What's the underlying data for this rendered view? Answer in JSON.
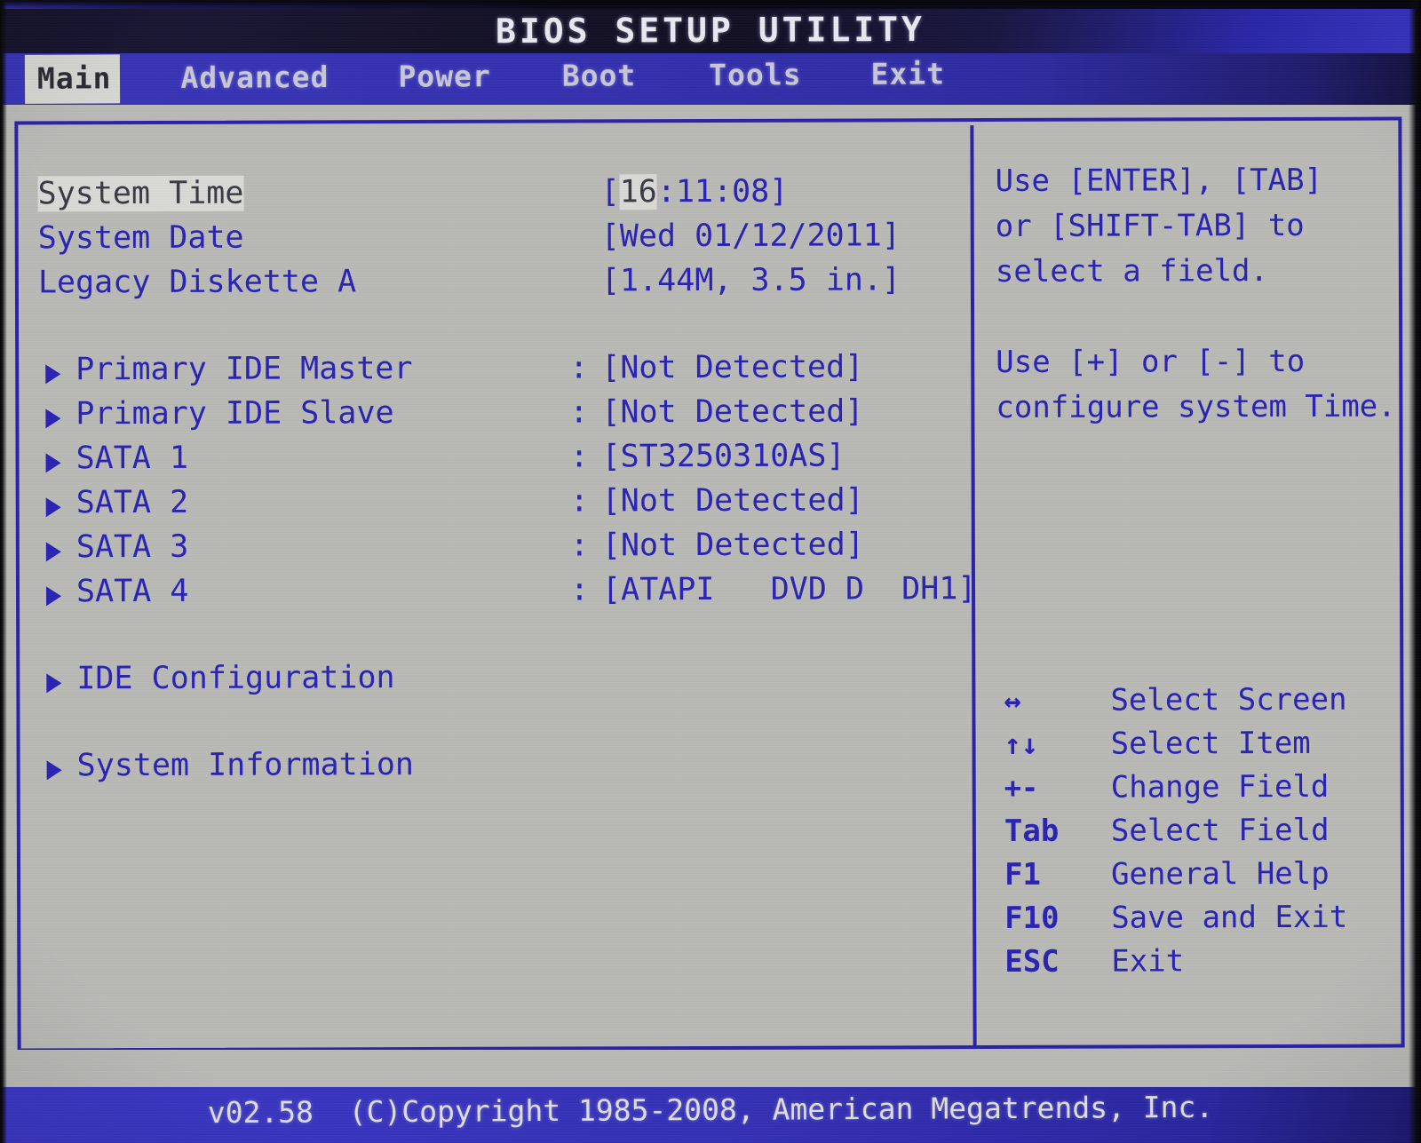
{
  "title": "BIOS SETUP UTILITY",
  "tabs": [
    {
      "label": "Main",
      "active": true
    },
    {
      "label": "Advanced",
      "active": false
    },
    {
      "label": "Power",
      "active": false
    },
    {
      "label": "Boot",
      "active": false
    },
    {
      "label": "Tools",
      "active": false
    },
    {
      "label": "Exit",
      "active": false
    }
  ],
  "main": {
    "system_time": {
      "label": "System Time",
      "value_prefix": "[",
      "value_selected": "16",
      "value_suffix": ":11:08]"
    },
    "system_date": {
      "label": "System Date",
      "value": "[Wed 01/12/2011]"
    },
    "legacy_diskette": {
      "label": "Legacy Diskette A",
      "value": "[1.44M, 3.5 in.]"
    },
    "drives": [
      {
        "label": "Primary IDE Master",
        "colon": ":",
        "value": "[Not Detected]"
      },
      {
        "label": "Primary IDE Slave",
        "colon": ":",
        "value": "[Not Detected]"
      },
      {
        "label": "SATA 1",
        "colon": ":",
        "value": "[ST3250310AS]"
      },
      {
        "label": "SATA 2",
        "colon": ":",
        "value": "[Not Detected]"
      },
      {
        "label": "SATA 3",
        "colon": ":",
        "value": "[Not Detected]"
      },
      {
        "label": "SATA 4",
        "colon": ":",
        "value": "[ATAPI   DVD D  DH1]"
      }
    ],
    "submenus": [
      {
        "label": "IDE Configuration"
      },
      {
        "label": "System Information"
      }
    ]
  },
  "help": {
    "line1": "Use [ENTER], [TAB]",
    "line2": "or [SHIFT-TAB] to",
    "line3": "select a field.",
    "line4": "Use [+] or [-] to",
    "line5": "configure system Time."
  },
  "keys": [
    {
      "key": "↔",
      "desc": "Select Screen"
    },
    {
      "key": "↑↓",
      "desc": "Select Item"
    },
    {
      "key": "+-",
      "desc": "Change Field"
    },
    {
      "key": "Tab",
      "desc": "Select Field"
    },
    {
      "key": "F1",
      "desc": "General Help"
    },
    {
      "key": "F10",
      "desc": "Save and Exit"
    },
    {
      "key": "ESC",
      "desc": "Exit"
    }
  ],
  "footer": {
    "text": "v02.58  (C)Copyright 1985-2008, American Megatrends, Inc."
  },
  "colors": {
    "text_blue": "#2a22b4",
    "panel_bg": "#b9b9b6",
    "bar_blue": "#3531b6",
    "selected_bg": "#d9d9d6"
  }
}
